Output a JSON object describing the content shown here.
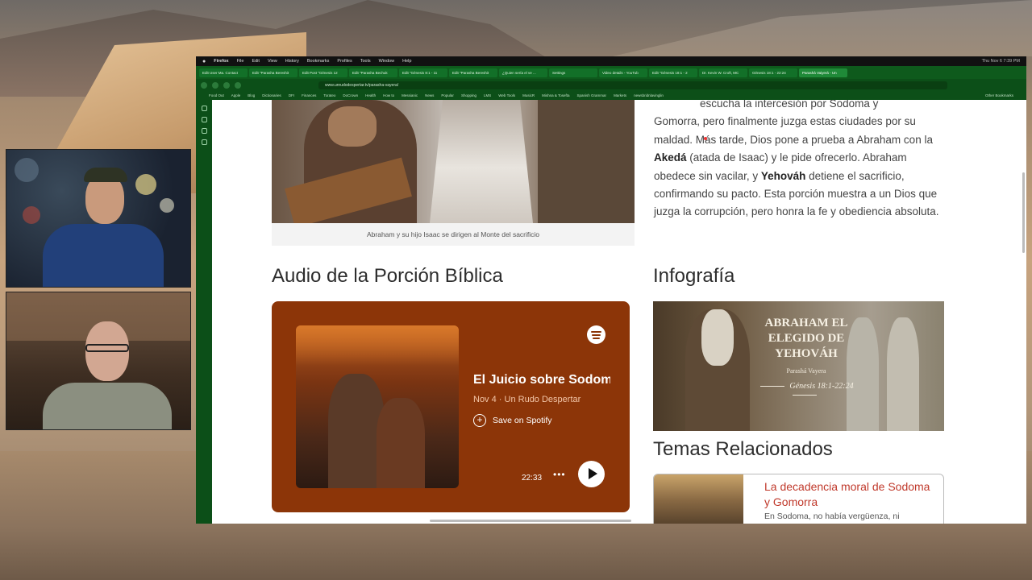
{
  "browser": {
    "menu": [
      "Firefox",
      "File",
      "Edit",
      "View",
      "History",
      "Bookmarks",
      "Profiles",
      "Tools",
      "Window",
      "Help"
    ],
    "clock": "Thu Nov 6  7:39 PM",
    "url": "www.unrudodespertar.tv/parasha-vayera/",
    "tabs": [
      "Edit User Ma. Contact",
      "Edit \"Parasha Bereshit",
      "Edit Post \"Génesis 12",
      "Edit \"Parasha Bechuk",
      "Edit \"Génesis 8:1 - 11",
      "Edit \"Parasha Bereshit",
      "¿Quien sería el ve ...",
      "Settings",
      "Video details - YouTub",
      "Edit \"Génesis 18:1 - 2",
      "Dr. Kevin W. Croft, MC",
      "Génesis 18:1 - 22:24",
      "Parashá Vaiyerá - Un"
    ],
    "bookmarks": [
      "Food Out",
      "Apple",
      "Blog",
      "Dictionaries",
      "DFI",
      "Finances",
      "Torateo",
      "DoCrown",
      "Health",
      "How to",
      "Messianic",
      "News",
      "Popular",
      "Shopping",
      "LMS",
      "Web Tools",
      "MusicR",
      "Mishna & Tosefta",
      "Spanish Grammar",
      "Markets",
      "newsbridnlavinglin",
      "Other Bookmarks"
    ]
  },
  "article": {
    "paragraph": {
      "line0": "escucha la intercesión por Sodoma y",
      "p1": "Gomorra, pero finalmente juzga estas ciudades por su maldad. Más tarde, Dios pone a prueba a Abraham con la ",
      "b1": "Akedá",
      "p2": " (atada de Isaac) y le pide ofrecerlo. Abraham obedece sin vacilar, y ",
      "b2": "Yehováh",
      "p3": " detiene el sacrificio, confirmando su pacto. Esta porción muestra a un Dios que juzga la corrupción, pero honra la fe y obediencia absoluta."
    },
    "hero_caption": "Abraham y su hijo Isaac se dirigen al Monte del sacrificio",
    "audio_heading": "Audio de la Porción Bíblica",
    "infografia_heading": "Infografía",
    "related_heading": "Temas Relacionados"
  },
  "spotify": {
    "title": "El Juicio sobre Sodoma",
    "subtitle": "Nov 4 · Un Rudo Despertar",
    "save_label": "Save on Spotify",
    "duration": "22:33",
    "more": "•••",
    "accent": "#8c3508"
  },
  "infographic": {
    "title": "ABRAHAM EL ELEGIDO DE YEHOVÁH",
    "subtitle": "Parashá Vayera",
    "reference": "Génesis 18:1-22:24"
  },
  "related": {
    "title": "La decadencia moral de Sodoma y Gomorra",
    "snippet": "En Sodoma, no había vergüenza, ni",
    "accent": "#c0392b"
  }
}
